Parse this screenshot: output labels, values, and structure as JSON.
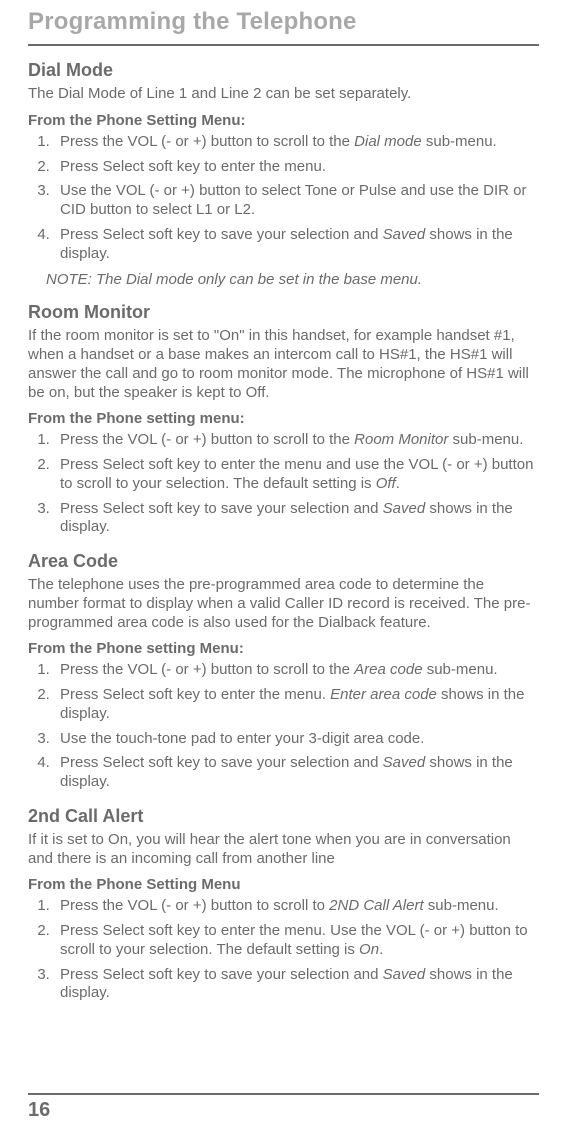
{
  "chapter": "Programming the Telephone",
  "pageNumber": "16",
  "sections": {
    "dialMode": {
      "title": "Dial Mode",
      "intro": "The Dial Mode of Line 1 and Line 2 can be set separately.",
      "sub": "From the Phone Setting Menu:",
      "steps": [
        {
          "pre": "Press the VOL (- or +) button to scroll to the ",
          "em": "Dial mode",
          "post": " sub-menu."
        },
        {
          "pre": "Press Select soft key to enter the menu.",
          "em": "",
          "post": ""
        },
        {
          "pre": "Use the VOL (- or +) button to select Tone or Pulse and use the DIR or CID button to select L1 or L2.",
          "em": "",
          "post": ""
        },
        {
          "pre": "Press Select soft key to save your selection and ",
          "em": "Saved",
          "post": " shows in the display."
        }
      ],
      "note": "NOTE: The Dial mode only can be set in the base menu."
    },
    "roomMonitor": {
      "title": "Room Monitor",
      "intro": "If the room monitor is set to \"On\" in this handset, for example handset #1, when a handset or a base makes an intercom call to HS#1, the HS#1 will answer the call and go to room monitor mode. The microphone of HS#1 will be on, but the speaker is kept to Off.",
      "sub": "From the Phone setting menu:",
      "steps": [
        {
          "pre": "Press the VOL (- or +) button to scroll to the ",
          "em": "Room Monitor",
          "post": " sub-menu."
        },
        {
          "pre": "Press Select soft key to enter the menu and use the VOL (- or +) button to scroll to your selection. The default setting is ",
          "em": "Off",
          "post": "."
        },
        {
          "pre": "Press Select soft key to save your selection and ",
          "em": "Saved",
          "post": " shows in the display."
        }
      ]
    },
    "areaCode": {
      "title": "Area Code",
      "intro": "The telephone uses the pre-programmed area code to determine the number format to display when a valid Caller ID record is received. The pre-programmed area code is also used for the Dialback feature.",
      "sub": "From the Phone setting Menu:",
      "steps": [
        {
          "pre": "Press the VOL (- or +) button to scroll to the ",
          "em": "Area code",
          "post": " sub-menu."
        },
        {
          "pre": "Press Select soft key to enter the menu. ",
          "em": "Enter area code",
          "post": " shows in the display."
        },
        {
          "pre": "Use the touch-tone pad to enter your 3-digit area code.",
          "em": "",
          "post": ""
        },
        {
          "pre": "Press Select soft key to save your selection and ",
          "em": "Saved",
          "post": " shows in the display."
        }
      ]
    },
    "secondCallAlert": {
      "title": "2nd  Call Alert",
      "intro": "If it is set to On, you will hear the alert tone when you are in conversation and there is an incoming call from another line",
      "sub": "From the Phone Setting Menu",
      "steps": [
        {
          "pre": "Press the VOL (- or +) button to scroll to ",
          "em": "2ND Call Alert",
          "post": " sub-menu."
        },
        {
          "pre": "Press Select soft key to enter the menu. Use the VOL (- or +) button to scroll to your selection. The default setting is ",
          "em": "On",
          "post": "."
        },
        {
          "pre": "Press Select soft key to save your selection and ",
          "em": "Saved",
          "post": " shows in the display."
        }
      ]
    }
  }
}
